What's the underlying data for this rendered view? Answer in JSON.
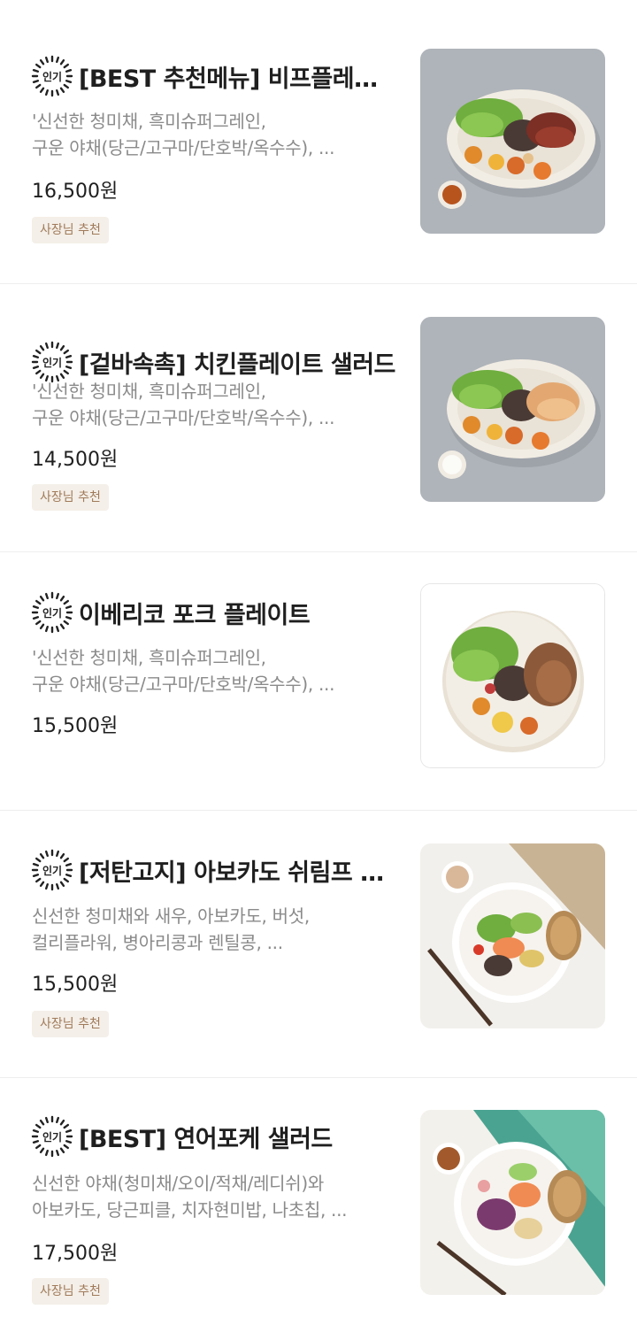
{
  "menu_items": [
    {
      "badge_text": "인기",
      "title": "[BEST 추천메뉴] 비프플레이트 샐러드",
      "desc_line1": "'신선한 청미채, 흑미슈퍼그레인,",
      "desc_line2": "구운 야채(당근/고구마/단호박/옥수수), ...",
      "price": "16,500원",
      "tag": "사장님 추천",
      "image": "beef-plate-photo"
    },
    {
      "badge_text": "인기",
      "title": "[겉바속촉] 치킨플레이트 샐러드",
      "desc_line1": "'신선한 청미채, 흑미슈퍼그레인,",
      "desc_line2": "구운 야채(당근/고구마/단호박/옥수수), ...",
      "price": "14,500원",
      "tag": "사장님 추천",
      "image": "chicken-plate-photo"
    },
    {
      "badge_text": "인기",
      "title": "이베리코 포크 플레이트",
      "desc_line1": "'신선한 청미채, 흑미슈퍼그레인,",
      "desc_line2": "구운 야채(당근/고구마/단호박/옥수수), ...",
      "price": "15,500원",
      "image": "pork-plate-photo"
    },
    {
      "badge_text": "인기",
      "title": "[저탄고지] 아보카도 쉬림프 샐러드",
      "desc_line1": "신선한 청미채와 새우, 아보카도, 버섯,",
      "desc_line2": "컬리플라워, 병아리콩과 렌틸콩, ...",
      "price": "15,500원",
      "tag": "사장님 추천",
      "image": "avocado-shrimp-bowl-photo"
    },
    {
      "badge_text": "인기",
      "title": "[BEST] 연어포케 샐러드",
      "desc_line1": "신선한 야채(청미채/오이/적채/레디쉬)와",
      "desc_line2": "아보카도, 당근피클, 치자현미밥, 나초칩, ...",
      "price": "17,500원",
      "tag": "사장님 추천",
      "image": "salmon-poke-bowl-photo"
    }
  ],
  "colors": {
    "tag_bg": "#f4efe8",
    "tag_text": "#a07a5a",
    "desc_text": "#8a8a8a",
    "title_text": "#1f1f1f"
  }
}
